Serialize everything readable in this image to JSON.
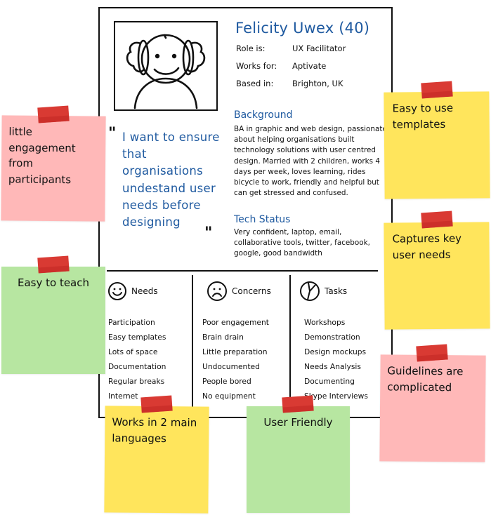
{
  "persona": {
    "name": "Felicity Uwex (40)",
    "details": [
      {
        "label": "Role is:",
        "value": "UX Facilitator"
      },
      {
        "label": "Works for:",
        "value": "Aptivate"
      },
      {
        "label": "Based in:",
        "value": "Brighton, UK"
      }
    ],
    "quote": "I want to ensure that organisations undestand user needs before designing",
    "quote_open": "\"",
    "quote_close": "\"",
    "background": {
      "title": "Background",
      "text": "BA in graphic and web design, passionate about helping organisations built technology solutions with user centred design. Married with 2 children, works 4 days per week, loves learning, rides bicycle to work, friendly and helpful but can get stressed and confused."
    },
    "tech_status": {
      "title": "Tech Status",
      "text": "Very confident, laptop, email, collaborative tools, twitter, facebook, google, good bandwidth"
    },
    "columns": [
      {
        "title": "Needs",
        "icon": "smiley-icon",
        "items": [
          "Participation",
          "Easy templates",
          "Lots of space",
          "Documentation",
          "Regular breaks",
          "Internet"
        ]
      },
      {
        "title": "Concerns",
        "icon": "frown-icon",
        "items": [
          "Poor engagement",
          "Brain drain",
          "Little preparation",
          "Undocumented",
          "People bored",
          "No equipment"
        ]
      },
      {
        "title": "Tasks",
        "icon": "clock-icon",
        "items": [
          "Workshops",
          "Demonstration",
          "Design mockups",
          "Needs Analysis",
          "Documenting",
          "Skype Interviews"
        ]
      }
    ]
  },
  "notes": [
    {
      "text": "little engagement from participants",
      "color": "#ffb8b8"
    },
    {
      "text": "Easy to teach",
      "color": "#b7e6a1"
    },
    {
      "text": "Easy to use templates",
      "color": "#ffe55c"
    },
    {
      "text": "Captures key user needs",
      "color": "#ffe55c"
    },
    {
      "text": "Guidelines are complicated",
      "color": "#ffb8b8"
    },
    {
      "text": "Works in 2 main languages",
      "color": "#ffe55c"
    },
    {
      "text": "User Friendly",
      "color": "#b7e6a1"
    }
  ],
  "colors": {
    "accent": "#1f5aa0",
    "tape": "#d93a33",
    "line": "#111111"
  }
}
